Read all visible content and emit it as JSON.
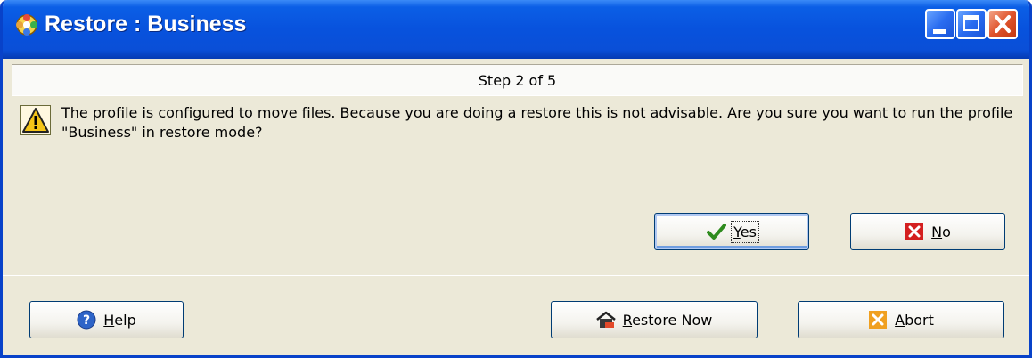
{
  "window": {
    "title": "Restore : Business"
  },
  "step": {
    "text": "Step 2 of 5"
  },
  "message": {
    "text": "The profile is configured to move files. Because you are doing a restore this is not advisable. Are you sure you want to run the profile \"Business\" in restore mode?"
  },
  "buttons": {
    "yes": {
      "mnemonic": "Y",
      "rest": "es"
    },
    "no": {
      "mnemonic": "N",
      "rest": "o"
    },
    "help": {
      "mnemonic": "H",
      "rest": "elp"
    },
    "restore_now": {
      "mnemonic": "R",
      "rest": "estore Now"
    },
    "abort": {
      "mnemonic": "A",
      "rest": "bort"
    }
  },
  "icons": {
    "title": "app-gear-icon",
    "warning": "warning-triangle-icon",
    "yes": "checkmark-icon",
    "no": "red-x-icon",
    "help": "help-question-icon",
    "restore_now": "restore-house-icon",
    "abort": "orange-x-icon"
  },
  "colors": {
    "titlebar": "#0852dd",
    "window_bg": "#ece9d8",
    "close_button": "#e0532b",
    "check": "#2e8b1e",
    "no_red": "#d41f1f",
    "abort_orange": "#f0a020"
  }
}
